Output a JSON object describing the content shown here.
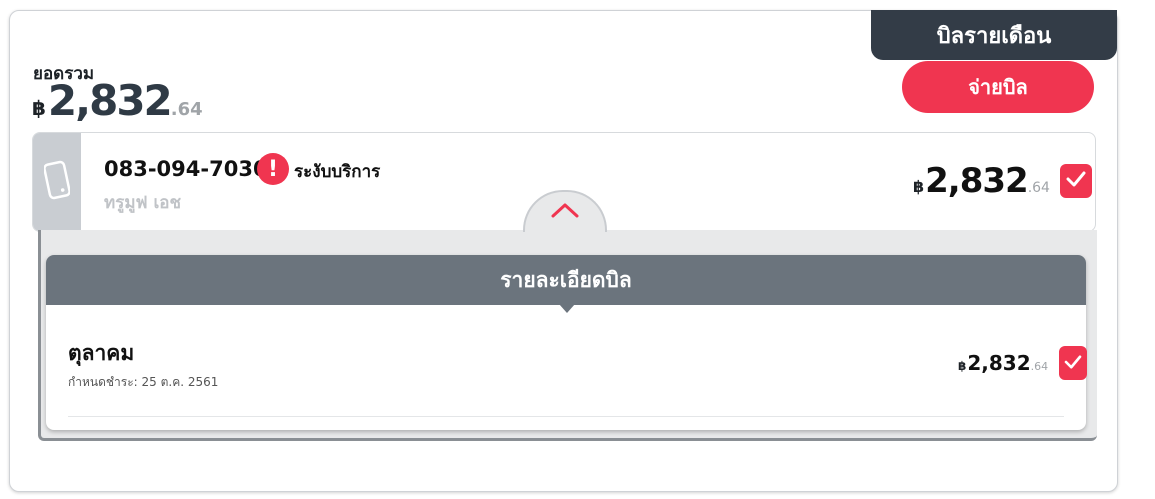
{
  "header": {
    "tab_label": "บิลรายเดือน",
    "total_label": "ยอดรวม",
    "currency": "฿",
    "total_main": "2,832",
    "total_decimal": ".64",
    "pay_button": "จ่ายบิล"
  },
  "account": {
    "icon": "mobile-phone-icon",
    "phone_number": "083-094-7030",
    "alert_icon": "exclamation-icon",
    "status": "ระงับบริการ",
    "plan": "ทรูมูฟ เอช",
    "currency": "฿",
    "amount_main": "2,832",
    "amount_decimal": ".64",
    "checked": true
  },
  "details": {
    "header": "รายละเอียดบิล",
    "bills": [
      {
        "month": "ตุลาคม",
        "due": "กำหนดชำระ: 25 ต.ค. 2561",
        "currency": "฿",
        "amount_main": "2,832",
        "amount_decimal": ".64",
        "checked": true
      }
    ]
  },
  "colors": {
    "accent": "#f03550",
    "dark_tab": "#333c47",
    "details_header": "#6b747d"
  }
}
